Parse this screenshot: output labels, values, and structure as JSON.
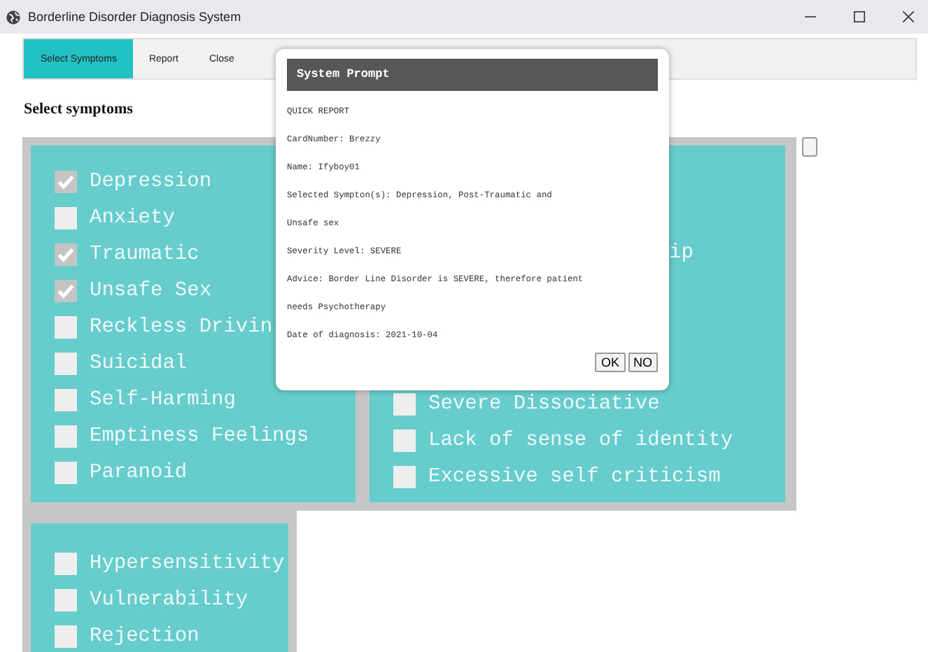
{
  "window": {
    "title": "Borderline Disorder Diagnosis System"
  },
  "tabs": [
    {
      "label": "Select Symptoms",
      "selected": true
    },
    {
      "label": "Report",
      "selected": false
    },
    {
      "label": "Close",
      "selected": false
    }
  ],
  "heading": "Select symptoms",
  "left_panel": [
    {
      "label": "Depression",
      "checked": true
    },
    {
      "label": "Anxiety",
      "checked": false
    },
    {
      "label": "Traumatic",
      "checked": true
    },
    {
      "label": "Unsafe Sex",
      "checked": true
    },
    {
      "label": "Reckless Drivin",
      "checked": false
    },
    {
      "label": "Suicidal",
      "checked": false
    },
    {
      "label": "Self-Harming",
      "checked": false
    },
    {
      "label": "Emptiness Feelings",
      "checked": false
    },
    {
      "label": "Paranoid",
      "checked": false
    }
  ],
  "right_panel": {
    "partial_text": "ip",
    "items": [
      {
        "label": "Severe Dissociative",
        "checked": false
      },
      {
        "label": "Lack of sense of identity",
        "checked": false
      },
      {
        "label": "Excessive self criticism",
        "checked": false
      }
    ]
  },
  "bottom_panel": [
    {
      "label": "Hypersensitivity",
      "checked": false
    },
    {
      "label": "Vulnerability",
      "checked": false
    },
    {
      "label": "Rejection",
      "checked": false
    }
  ],
  "dialog": {
    "title": "System Prompt",
    "lines": [
      "QUICK REPORT",
      "CardNumber: Brezzy",
      "Name: Ifyboy01",
      "Selected Sympton(s): Depression, Post-Traumatic and",
      "Unsafe sex",
      "Severity Level: SEVERE",
      "Advice: Border Line Disorder is SEVERE, therefore patient",
      "needs Psychotherapy",
      "Date of diagnosis: 2021-10-04"
    ],
    "buttons": [
      "OK",
      "NO"
    ]
  }
}
